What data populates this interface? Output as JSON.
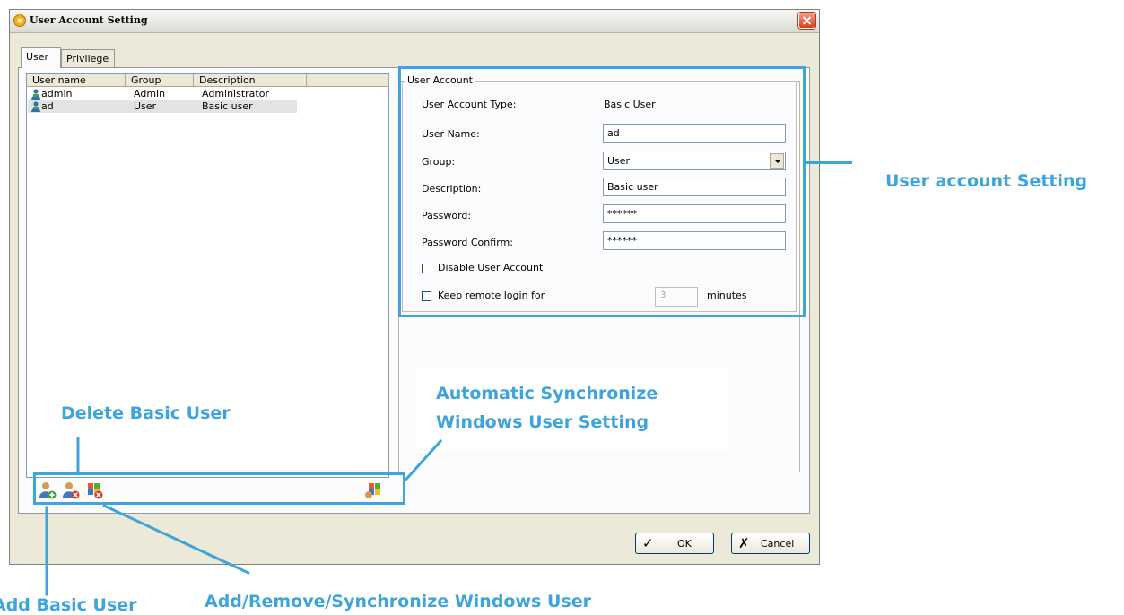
{
  "window": {
    "title": "User Account Setting"
  },
  "tabs": [
    {
      "label": "User"
    },
    {
      "label": "Privilege"
    }
  ],
  "user_list": {
    "columns": [
      "User name",
      "Group",
      "Description"
    ],
    "rows": [
      {
        "name": "admin",
        "group": "Admin",
        "description": "Administrator",
        "selected": false
      },
      {
        "name": "ad",
        "group": "User",
        "description": "Basic user",
        "selected": true
      }
    ]
  },
  "account": {
    "legend": "User Account",
    "type_label": "User Account Type:",
    "type_value": "Basic User",
    "username_label": "User Name:",
    "username_value": "ad",
    "group_label": "Group:",
    "group_value": "User",
    "description_label": "Description:",
    "description_value": "Basic user",
    "password_label": "Password:",
    "password_value": "******",
    "password_confirm_label": "Password Confirm:",
    "password_confirm_value": "******",
    "disable_label": "Disable User Account",
    "disable_checked": false,
    "keep_login_label": "Keep remote login for",
    "keep_login_checked": false,
    "keep_login_minutes": "3",
    "minutes_label": "minutes"
  },
  "toolbar": {
    "icons": [
      "add-basic-user-icon",
      "delete-basic-user-icon",
      "add-remove-sync-windows-user-icon",
      "auto-sync-windows-icon"
    ]
  },
  "buttons": {
    "ok": "OK",
    "cancel": "Cancel"
  },
  "annotations": {
    "user_account_setting": "User account Setting",
    "auto_sync_line1": "Automatic Synchronize",
    "auto_sync_line2": "Windows User Setting",
    "delete_basic_user": "Delete Basic User",
    "add_basic_user": "Add Basic User",
    "add_remove_sync": "Add/Remove/Synchronize Windows User"
  },
  "colors": {
    "annotation": "#3ea4dc",
    "selection": "#e3e3e3"
  }
}
